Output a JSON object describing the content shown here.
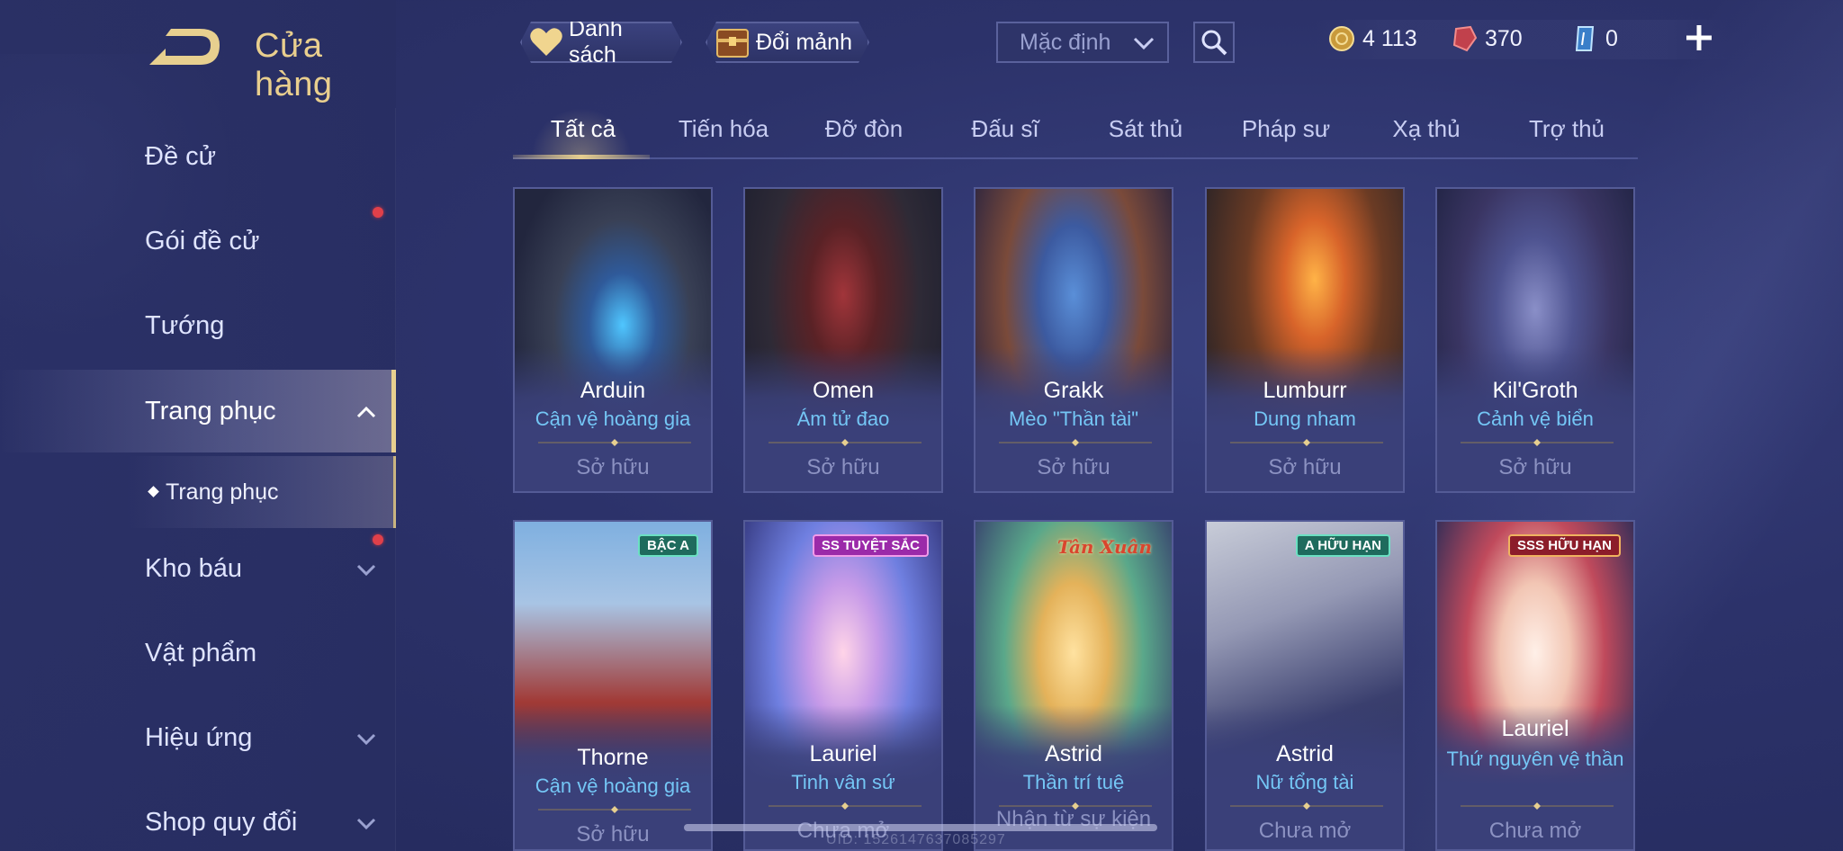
{
  "header": {
    "title": "Cửa hàng",
    "wishlist_label": "Danh sách",
    "exchange_label": "Đổi mảnh",
    "sort_value": "Mặc định"
  },
  "currencies": [
    {
      "icon": "gold-coin-icon",
      "value": "4 113"
    },
    {
      "icon": "ruby-gem-icon",
      "value": "370"
    },
    {
      "icon": "voucher-icon",
      "value": "0"
    }
  ],
  "sidebar": {
    "items": [
      {
        "label": "Đề cử"
      },
      {
        "label": "Gói đề cử"
      },
      {
        "label": "Tướng"
      },
      {
        "label": "Trang phục"
      },
      {
        "label": "Kho báu"
      },
      {
        "label": "Vật phẩm"
      },
      {
        "label": "Hiệu ứng"
      },
      {
        "label": "Shop quy đổi"
      }
    ],
    "sub_item": "Trang phục"
  },
  "tabs": [
    "Tất cả",
    "Tiến hóa",
    "Đỡ đòn",
    "Đấu sĩ",
    "Sát thủ",
    "Pháp sư",
    "Xạ thủ",
    "Trợ thủ"
  ],
  "cards": [
    {
      "hero": "Arduin",
      "skin": "Cận vệ hoàng gia",
      "status": "Sở hữu",
      "tag": ""
    },
    {
      "hero": "Omen",
      "skin": "Ám tử đao",
      "status": "Sở hữu",
      "tag": ""
    },
    {
      "hero": "Grakk",
      "skin": "Mèo \"Thần tài\"",
      "status": "Sở hữu",
      "tag": ""
    },
    {
      "hero": "Lumburr",
      "skin": "Dung nham",
      "status": "Sở hữu",
      "tag": ""
    },
    {
      "hero": "Kil'Groth",
      "skin": "Cảnh vệ biển",
      "status": "Sở hữu",
      "tag": ""
    },
    {
      "hero": "Thorne",
      "skin": "Cận vệ hoàng gia",
      "status": "Sở hữu",
      "tag": "BẬC A"
    },
    {
      "hero": "Lauriel",
      "skin": "Tinh vân sứ",
      "status": "Chưa mở",
      "tag": "SS TUYỆT SẮC"
    },
    {
      "hero": "Astrid",
      "skin": "Thần trí tuệ",
      "status": "Nhận từ sự kiện",
      "tag": "Tân Xuân"
    },
    {
      "hero": "Astrid",
      "skin": "Nữ tổng tài",
      "status": "Chưa mở",
      "tag": "A HỮU HẠN"
    },
    {
      "hero": "Lauriel",
      "skin": "Thứ nguyên vệ thần",
      "status": "Chưa mở",
      "tag": "SSS HỮU HẠN"
    }
  ],
  "footer": {
    "uid": "UID: 1526147637085297"
  },
  "colors": {
    "accent_gold": "#e7cf8f",
    "skin_blue": "#74c6f5",
    "status_gray": "#8c92c2"
  }
}
